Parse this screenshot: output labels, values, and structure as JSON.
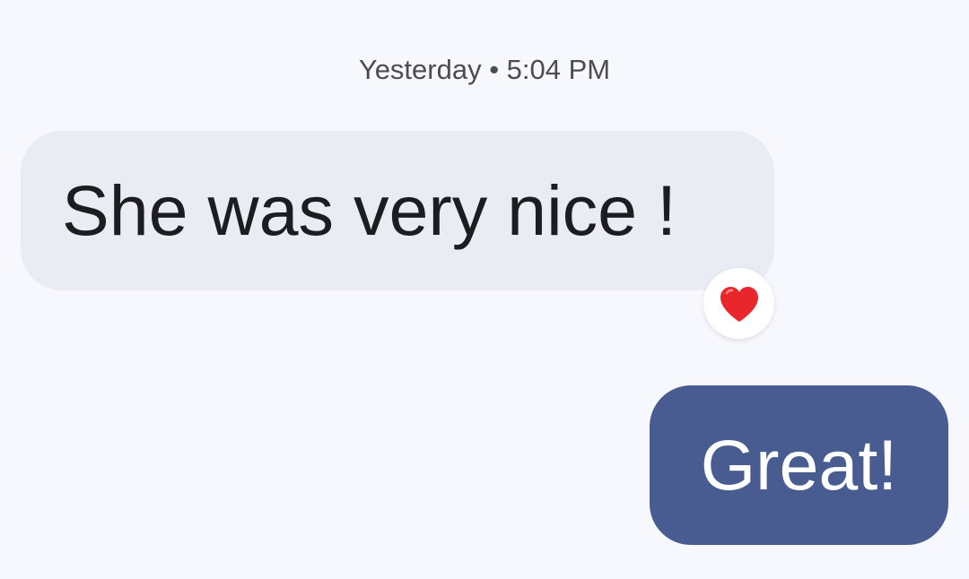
{
  "conversation": {
    "timestamp": "Yesterday • 5:04 PM",
    "messages": [
      {
        "direction": "incoming",
        "text": "She was very nice !",
        "reaction": "heart-emoji"
      },
      {
        "direction": "outgoing",
        "text": "Great!"
      }
    ]
  },
  "colors": {
    "background": "#f6f8fd",
    "incoming_bubble": "#e9ecf3",
    "outgoing_bubble": "#485c91",
    "heart": "#e8262b"
  }
}
